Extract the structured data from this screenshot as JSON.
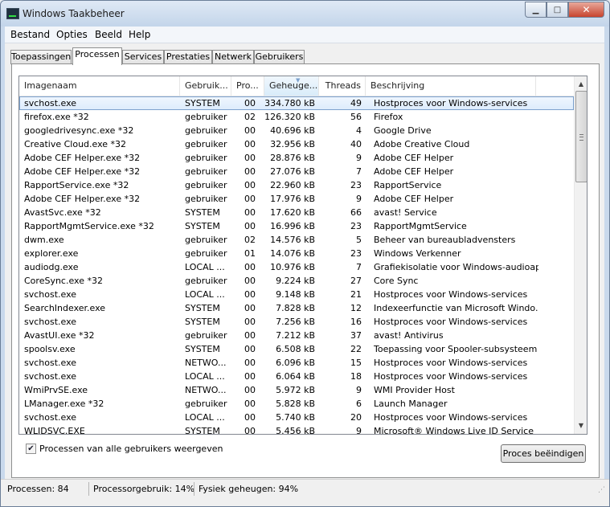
{
  "window": {
    "title": "Windows Taakbeheer"
  },
  "menu": [
    {
      "label": "Bestand"
    },
    {
      "label": "Opties"
    },
    {
      "label": "Beeld"
    },
    {
      "label": "Help"
    }
  ],
  "tabs": [
    {
      "label": "Toepassingen",
      "active": false
    },
    {
      "label": "Processen",
      "active": true
    },
    {
      "label": "Services",
      "active": false
    },
    {
      "label": "Prestaties",
      "active": false
    },
    {
      "label": "Netwerk",
      "active": false
    },
    {
      "label": "Gebruikers",
      "active": false
    }
  ],
  "columns": [
    {
      "label": "Imagenaam"
    },
    {
      "label": "Gebruik..."
    },
    {
      "label": "Pro..."
    },
    {
      "label": "Geheuge..."
    },
    {
      "label": "Threads"
    },
    {
      "label": "Beschrijving"
    }
  ],
  "sorted_column": "Geheuge...",
  "processes": [
    {
      "name": "svchost.exe",
      "user": "SYSTEM",
      "cpu": "00",
      "mem": "334.780 kB",
      "threads": "49",
      "desc": "Hostproces voor Windows-services",
      "selected": true
    },
    {
      "name": "firefox.exe *32",
      "user": "gebruiker",
      "cpu": "02",
      "mem": "126.320 kB",
      "threads": "56",
      "desc": "Firefox"
    },
    {
      "name": "googledrivesync.exe *32",
      "user": "gebruiker",
      "cpu": "00",
      "mem": "40.696 kB",
      "threads": "4",
      "desc": "Google Drive"
    },
    {
      "name": "Creative Cloud.exe *32",
      "user": "gebruiker",
      "cpu": "00",
      "mem": "32.956 kB",
      "threads": "40",
      "desc": "Adobe Creative Cloud"
    },
    {
      "name": "Adobe CEF Helper.exe *32",
      "user": "gebruiker",
      "cpu": "00",
      "mem": "28.876 kB",
      "threads": "9",
      "desc": "Adobe CEF Helper"
    },
    {
      "name": "Adobe CEF Helper.exe *32",
      "user": "gebruiker",
      "cpu": "00",
      "mem": "27.076 kB",
      "threads": "7",
      "desc": "Adobe CEF Helper"
    },
    {
      "name": "RapportService.exe *32",
      "user": "gebruiker",
      "cpu": "00",
      "mem": "22.960 kB",
      "threads": "23",
      "desc": "RapportService"
    },
    {
      "name": "Adobe CEF Helper.exe *32",
      "user": "gebruiker",
      "cpu": "00",
      "mem": "17.976 kB",
      "threads": "9",
      "desc": "Adobe CEF Helper"
    },
    {
      "name": "AvastSvc.exe *32",
      "user": "SYSTEM",
      "cpu": "00",
      "mem": "17.620 kB",
      "threads": "66",
      "desc": "avast! Service"
    },
    {
      "name": "RapportMgmtService.exe *32",
      "user": "SYSTEM",
      "cpu": "00",
      "mem": "16.996 kB",
      "threads": "23",
      "desc": "RapportMgmtService"
    },
    {
      "name": "dwm.exe",
      "user": "gebruiker",
      "cpu": "02",
      "mem": "14.576 kB",
      "threads": "5",
      "desc": "Beheer van bureaubladvensters"
    },
    {
      "name": "explorer.exe",
      "user": "gebruiker",
      "cpu": "01",
      "mem": "14.076 kB",
      "threads": "23",
      "desc": "Windows Verkenner"
    },
    {
      "name": "audiodg.exe",
      "user": "LOCAL ...",
      "cpu": "00",
      "mem": "10.976 kB",
      "threads": "7",
      "desc": "Grafiekisolatie voor Windows-audioap..."
    },
    {
      "name": "CoreSync.exe *32",
      "user": "gebruiker",
      "cpu": "00",
      "mem": "9.224 kB",
      "threads": "27",
      "desc": "Core Sync"
    },
    {
      "name": "svchost.exe",
      "user": "LOCAL ...",
      "cpu": "00",
      "mem": "9.148 kB",
      "threads": "21",
      "desc": "Hostproces voor Windows-services"
    },
    {
      "name": "SearchIndexer.exe",
      "user": "SYSTEM",
      "cpu": "00",
      "mem": "7.828 kB",
      "threads": "12",
      "desc": "Indexeerfunctie van Microsoft Windo..."
    },
    {
      "name": "svchost.exe",
      "user": "SYSTEM",
      "cpu": "00",
      "mem": "7.256 kB",
      "threads": "16",
      "desc": "Hostproces voor Windows-services"
    },
    {
      "name": "AvastUI.exe *32",
      "user": "gebruiker",
      "cpu": "00",
      "mem": "7.212 kB",
      "threads": "37",
      "desc": "avast! Antivirus"
    },
    {
      "name": "spoolsv.exe",
      "user": "SYSTEM",
      "cpu": "00",
      "mem": "6.508 kB",
      "threads": "22",
      "desc": "Toepassing voor Spooler-subsysteem"
    },
    {
      "name": "svchost.exe",
      "user": "NETWO...",
      "cpu": "00",
      "mem": "6.096 kB",
      "threads": "15",
      "desc": "Hostproces voor Windows-services"
    },
    {
      "name": "svchost.exe",
      "user": "LOCAL ...",
      "cpu": "00",
      "mem": "6.064 kB",
      "threads": "18",
      "desc": "Hostproces voor Windows-services"
    },
    {
      "name": "WmiPrvSE.exe",
      "user": "NETWO...",
      "cpu": "00",
      "mem": "5.972 kB",
      "threads": "9",
      "desc": "WMI Provider Host"
    },
    {
      "name": "LManager.exe *32",
      "user": "gebruiker",
      "cpu": "00",
      "mem": "5.828 kB",
      "threads": "6",
      "desc": "Launch Manager"
    },
    {
      "name": "svchost.exe",
      "user": "LOCAL ...",
      "cpu": "00",
      "mem": "5.740 kB",
      "threads": "20",
      "desc": "Hostproces voor Windows-services"
    },
    {
      "name": "WLIDSVC.EXE",
      "user": "SYSTEM",
      "cpu": "00",
      "mem": "5.456 kB",
      "threads": "9",
      "desc": "Microsoft® Windows Live ID Service"
    }
  ],
  "show_all_users": {
    "label": "Processen van alle gebruikers weergeven",
    "checked": true
  },
  "end_process_button": "Proces beëindigen",
  "status": {
    "processes": "Processen: 84",
    "cpu": "Processorgebruik: 14%",
    "memory": "Fysiek geheugen: 94%"
  }
}
